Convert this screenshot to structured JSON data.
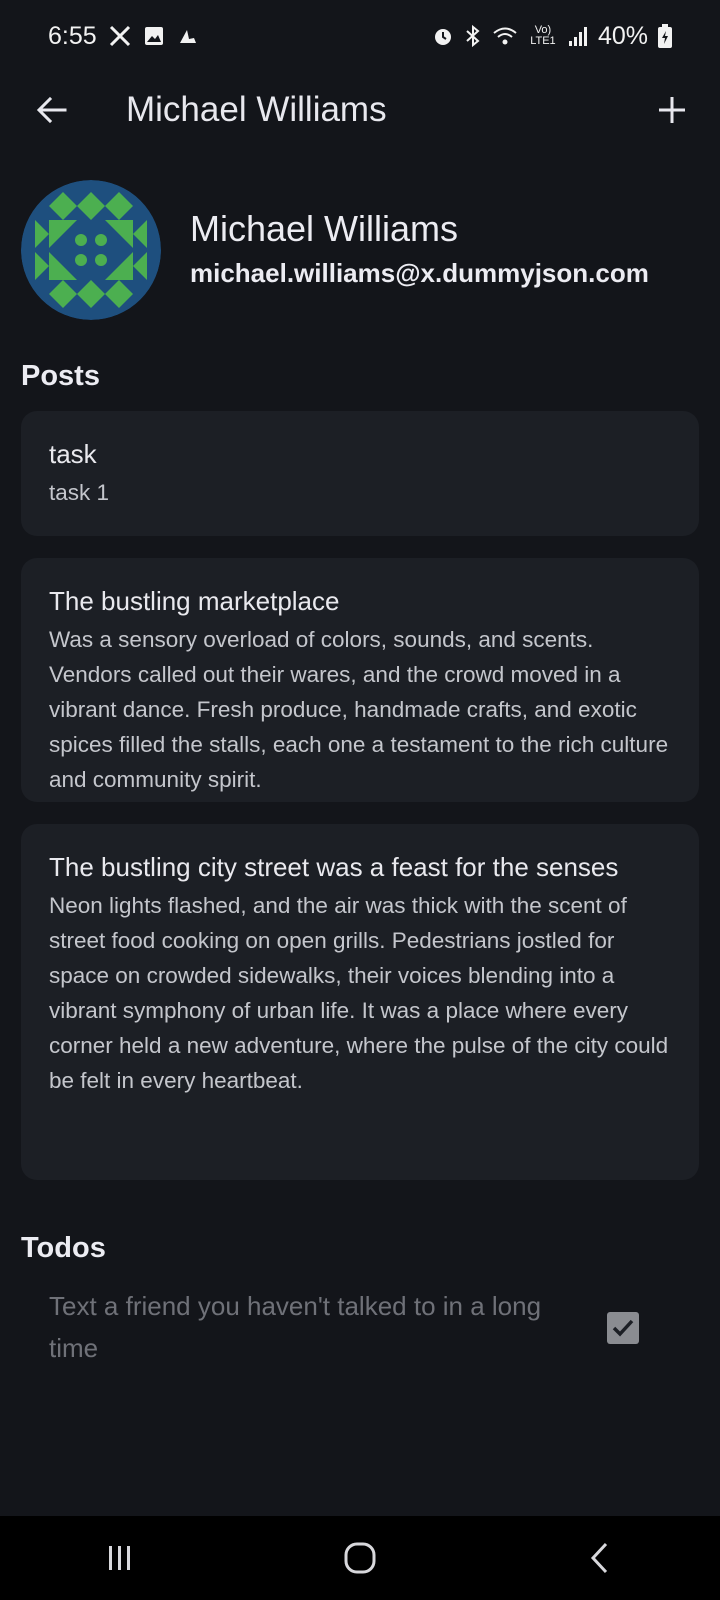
{
  "status_bar": {
    "time": "6:55",
    "battery": "40%",
    "left_icons": [
      "x-icon",
      "gallery-icon",
      "weather-icon"
    ],
    "right_icons": [
      "alarm-icon",
      "bluetooth-icon",
      "wifi-icon",
      "volte-icon",
      "signal-icon",
      "battery-icon"
    ],
    "volte_label": "Vo) LTE1"
  },
  "app_bar": {
    "title": "Michael Williams",
    "back_icon": "arrow-back-icon",
    "add_icon": "plus-icon"
  },
  "profile": {
    "name": "Michael Williams",
    "email": "michael.williams@x.dummyjson.com",
    "avatar_colors": {
      "background": "#1e4f7e",
      "pattern": "#4caf50"
    }
  },
  "posts": {
    "section_title": "Posts",
    "items": [
      {
        "title": "task",
        "body": "task 1"
      },
      {
        "title": "The bustling marketplace",
        "body": "Was a sensory overload of colors, sounds, and scents. Vendors called out their wares, and the crowd moved in a vibrant dance. Fresh produce, handmade crafts, and exotic spices filled the stalls, each one a testament to the rich culture and community spirit."
      },
      {
        "title": "The bustling city street was a feast for the senses",
        "body": "Neon lights flashed, and the air was thick with the scent of street food cooking on open grills. Pedestrians jostled for space on crowded sidewalks, their voices blending into a vibrant symphony of urban life. It was a place where every corner held a new adventure, where the pulse of the city could be felt in every heartbeat."
      }
    ]
  },
  "todos": {
    "section_title": "Todos",
    "items": [
      {
        "text": "Text a friend you haven't talked to in a long time",
        "completed": true
      }
    ]
  },
  "nav_bar": {
    "buttons": [
      "recents-icon",
      "home-icon",
      "back-icon"
    ]
  },
  "colors": {
    "background": "#13151a",
    "card": "#1c1f25",
    "text_primary": "#e9e9ee",
    "text_secondary": "#c4c6cc",
    "todo_text": "#6f7178",
    "checkbox": "#8a8c91"
  }
}
